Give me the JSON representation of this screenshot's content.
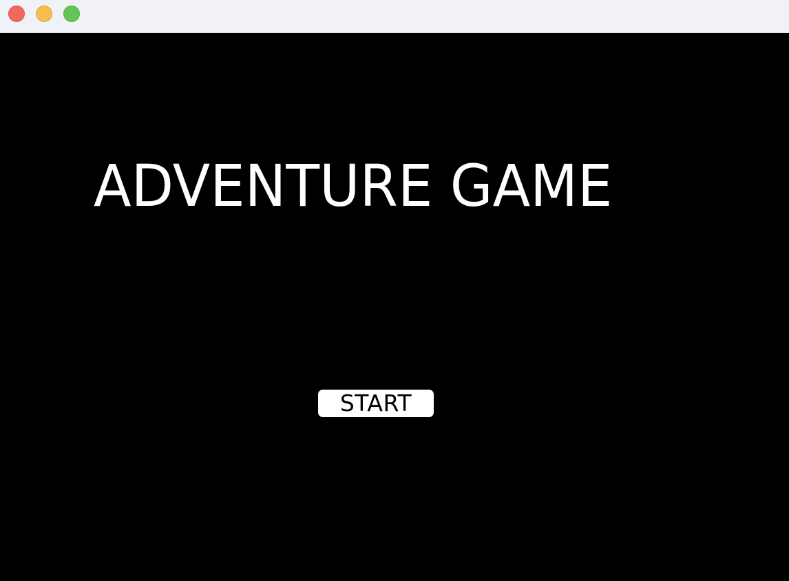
{
  "window": {
    "controls": [
      "close",
      "minimize",
      "zoom"
    ]
  },
  "game": {
    "title": "ADVENTURE GAME",
    "start_label": "START"
  },
  "colors": {
    "background": "#000000",
    "title_text": "#ffffff",
    "button_background": "#ffffff",
    "button_text": "#000000",
    "titlebar": "#f1f2f7"
  }
}
